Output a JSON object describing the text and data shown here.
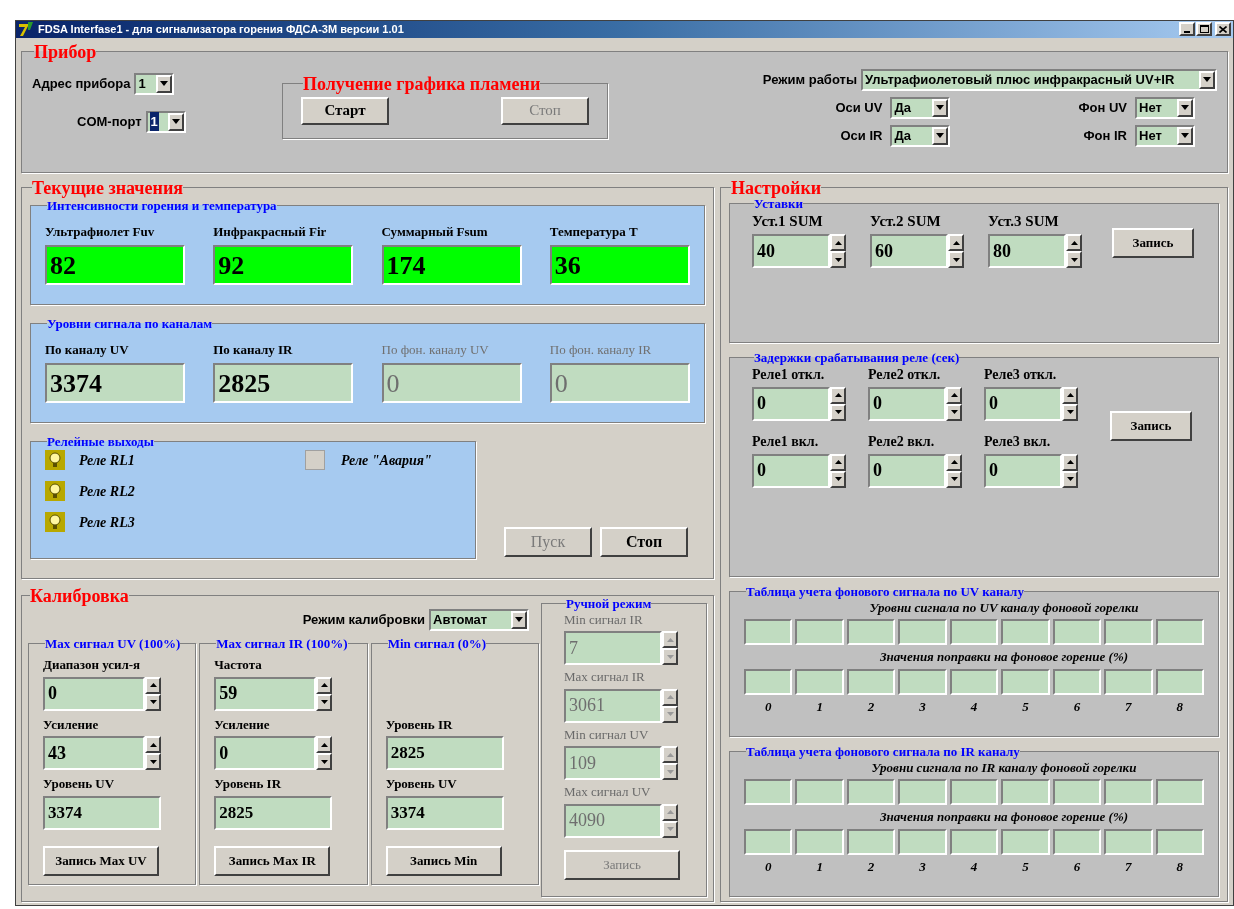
{
  "window": {
    "title": "FDSA Interfase1 - для сигнализатора горения ФДСА-3М версии 1.01"
  },
  "device": {
    "title": "Прибор",
    "address": {
      "label": "Адрес прибора",
      "value": "1",
      "focused": false
    },
    "com_port": {
      "label": "COM-порт",
      "value": "1",
      "focused": true
    },
    "flame_graph": {
      "title": "Получение графика пламени",
      "buttons": [
        {
          "label": "Старт",
          "disabled": false
        },
        {
          "label": "Стоп",
          "disabled": true
        }
      ]
    },
    "mode": {
      "label": "Режим работы",
      "value": "Ультрафиолетовый плюс инфракрасный UV+IR"
    },
    "options": [
      {
        "label": "Оси UV",
        "value": "Да"
      },
      {
        "label": "Фон UV",
        "value": "Нет"
      },
      {
        "label": "Оси IR",
        "value": "Да"
      },
      {
        "label": "Фон IR",
        "value": "Нет"
      }
    ]
  },
  "current": {
    "title": "Текущие значения",
    "intensity": {
      "title": "Интенсивности горения и температура",
      "fields": [
        {
          "label": "Ультрафиолет Fuv",
          "value": "82"
        },
        {
          "label": "Инфракрасный Fir",
          "value": "92"
        },
        {
          "label": "Суммарный Fsum",
          "value": "174"
        },
        {
          "label": "Температура T",
          "value": "36"
        }
      ]
    },
    "signal_levels": {
      "title": "Уровни сигнала по каналам",
      "fields": [
        {
          "label": "По каналу UV",
          "value": "3374",
          "disabled": false
        },
        {
          "label": "По каналу IR",
          "value": "2825",
          "disabled": false
        },
        {
          "label": "По фон. каналу UV",
          "value": "0",
          "disabled": true
        },
        {
          "label": "По фон. каналу IR",
          "value": "0",
          "disabled": true
        }
      ]
    },
    "relays": {
      "title": "Релейные выходы",
      "items": [
        {
          "label": "Реле RL1",
          "kind": "lamp"
        },
        {
          "label": "Реле RL2",
          "kind": "lamp"
        },
        {
          "label": "Реле RL3",
          "kind": "lamp"
        },
        {
          "label": "Реле \"Авария\"",
          "kind": "square"
        }
      ]
    },
    "buttons": [
      {
        "label": "Пуск",
        "disabled": true
      },
      {
        "label": "Стоп",
        "disabled": false
      }
    ]
  },
  "settings": {
    "title": "Настройки",
    "setpoints": {
      "title": "Уставки",
      "fields": [
        {
          "label": "Уст.1 SUM",
          "value": "40"
        },
        {
          "label": "Уст.2 SUM",
          "value": "60"
        },
        {
          "label": "Уст.3 SUM",
          "value": "80"
        }
      ],
      "button": "Запись"
    },
    "delays": {
      "title": "Задержки срабатывания реле (сек)",
      "fields": [
        {
          "label": "Реле1 откл.",
          "value": "0"
        },
        {
          "label": "Реле2 откл.",
          "value": "0"
        },
        {
          "label": "Реле3 откл.",
          "value": "0"
        },
        {
          "label": "Реле1 вкл.",
          "value": "0"
        },
        {
          "label": "Реле2 вкл.",
          "value": "0"
        },
        {
          "label": "Реле3 вкл.",
          "value": "0"
        }
      ],
      "button": "Запись"
    },
    "tables": [
      {
        "title": "Таблица учета фонового сигнала по UV каналу",
        "levels_label": "Уровни сигнала по UV каналу фоновой горелки",
        "corrections_label": "Значения поправки на фоновое горение (%)",
        "indices": [
          "0",
          "1",
          "2",
          "3",
          "4",
          "5",
          "6",
          "7",
          "8"
        ]
      },
      {
        "title": "Таблица учета фонового сигнала по IR каналу",
        "levels_label": "Уровни сигнала по IR каналу фоновой горелки",
        "corrections_label": "Значения поправки на фоновое горение (%)",
        "indices": [
          "0",
          "1",
          "2",
          "3",
          "4",
          "5",
          "6",
          "7",
          "8"
        ]
      }
    ]
  },
  "calibration": {
    "title": "Калибровка",
    "mode": {
      "label": "Режим калибровки",
      "value": "Автомат"
    },
    "groups": [
      {
        "title": "Max сигнал UV (100%)",
        "fields": [
          {
            "label": "Диапазон усил-я",
            "value": "0",
            "kind": "spin"
          },
          {
            "label": "Усиление",
            "value": "43",
            "kind": "spin"
          },
          {
            "label": "Уровень UV",
            "value": "3374",
            "kind": "text"
          }
        ],
        "button": "Запись Max UV"
      },
      {
        "title": "Max сигнал IR (100%)",
        "fields": [
          {
            "label": "Частота",
            "value": "59",
            "kind": "spin"
          },
          {
            "label": "Усиление",
            "value": "0",
            "kind": "spin"
          },
          {
            "label": "Уровень IR",
            "value": "2825",
            "kind": "text"
          }
        ],
        "button": "Запись Max IR"
      },
      {
        "title": "Min сигнал (0%)",
        "fields": [
          {
            "label": "Уровень IR",
            "value": "2825",
            "kind": "text"
          },
          {
            "label": "Уровень UV",
            "value": "3374",
            "kind": "text"
          }
        ],
        "button": "Запись Min"
      }
    ],
    "manual": {
      "title": "Ручной режим",
      "fields": [
        {
          "label": "Min сигнал IR",
          "value": "7",
          "disabled": true
        },
        {
          "label": "Max сигнал IR",
          "value": "3061",
          "disabled": true
        },
        {
          "label": "Min сигнал UV",
          "value": "109",
          "disabled": true
        },
        {
          "label": "Max сигнал UV",
          "value": "4090",
          "disabled": true
        }
      ],
      "button": {
        "label": "Запись",
        "disabled": true
      }
    }
  }
}
